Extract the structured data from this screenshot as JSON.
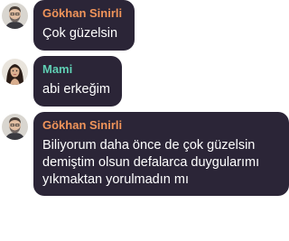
{
  "colors": {
    "bubble": "#2b2537",
    "sender_orange": "#f0945a",
    "sender_teal": "#5fcfb4",
    "message_text": "#ffffff"
  },
  "messages": [
    {
      "sender": "Gökhan Sinirli",
      "sender_color": "#f0945a",
      "avatar": "bearded-man-avatar",
      "text": "Çok güzelsin"
    },
    {
      "sender": "Mami",
      "sender_color": "#5fcfb4",
      "avatar": "woman-avatar",
      "text": "abi erkeğim"
    },
    {
      "sender": "Gökhan Sinirli",
      "sender_color": "#f0945a",
      "avatar": "bearded-man-avatar",
      "text": "Biliyorum daha önce de çok güzelsin\ndemiştim olsun defalarca duygularımı\nyıkmaktan yorulmadın mı"
    }
  ]
}
